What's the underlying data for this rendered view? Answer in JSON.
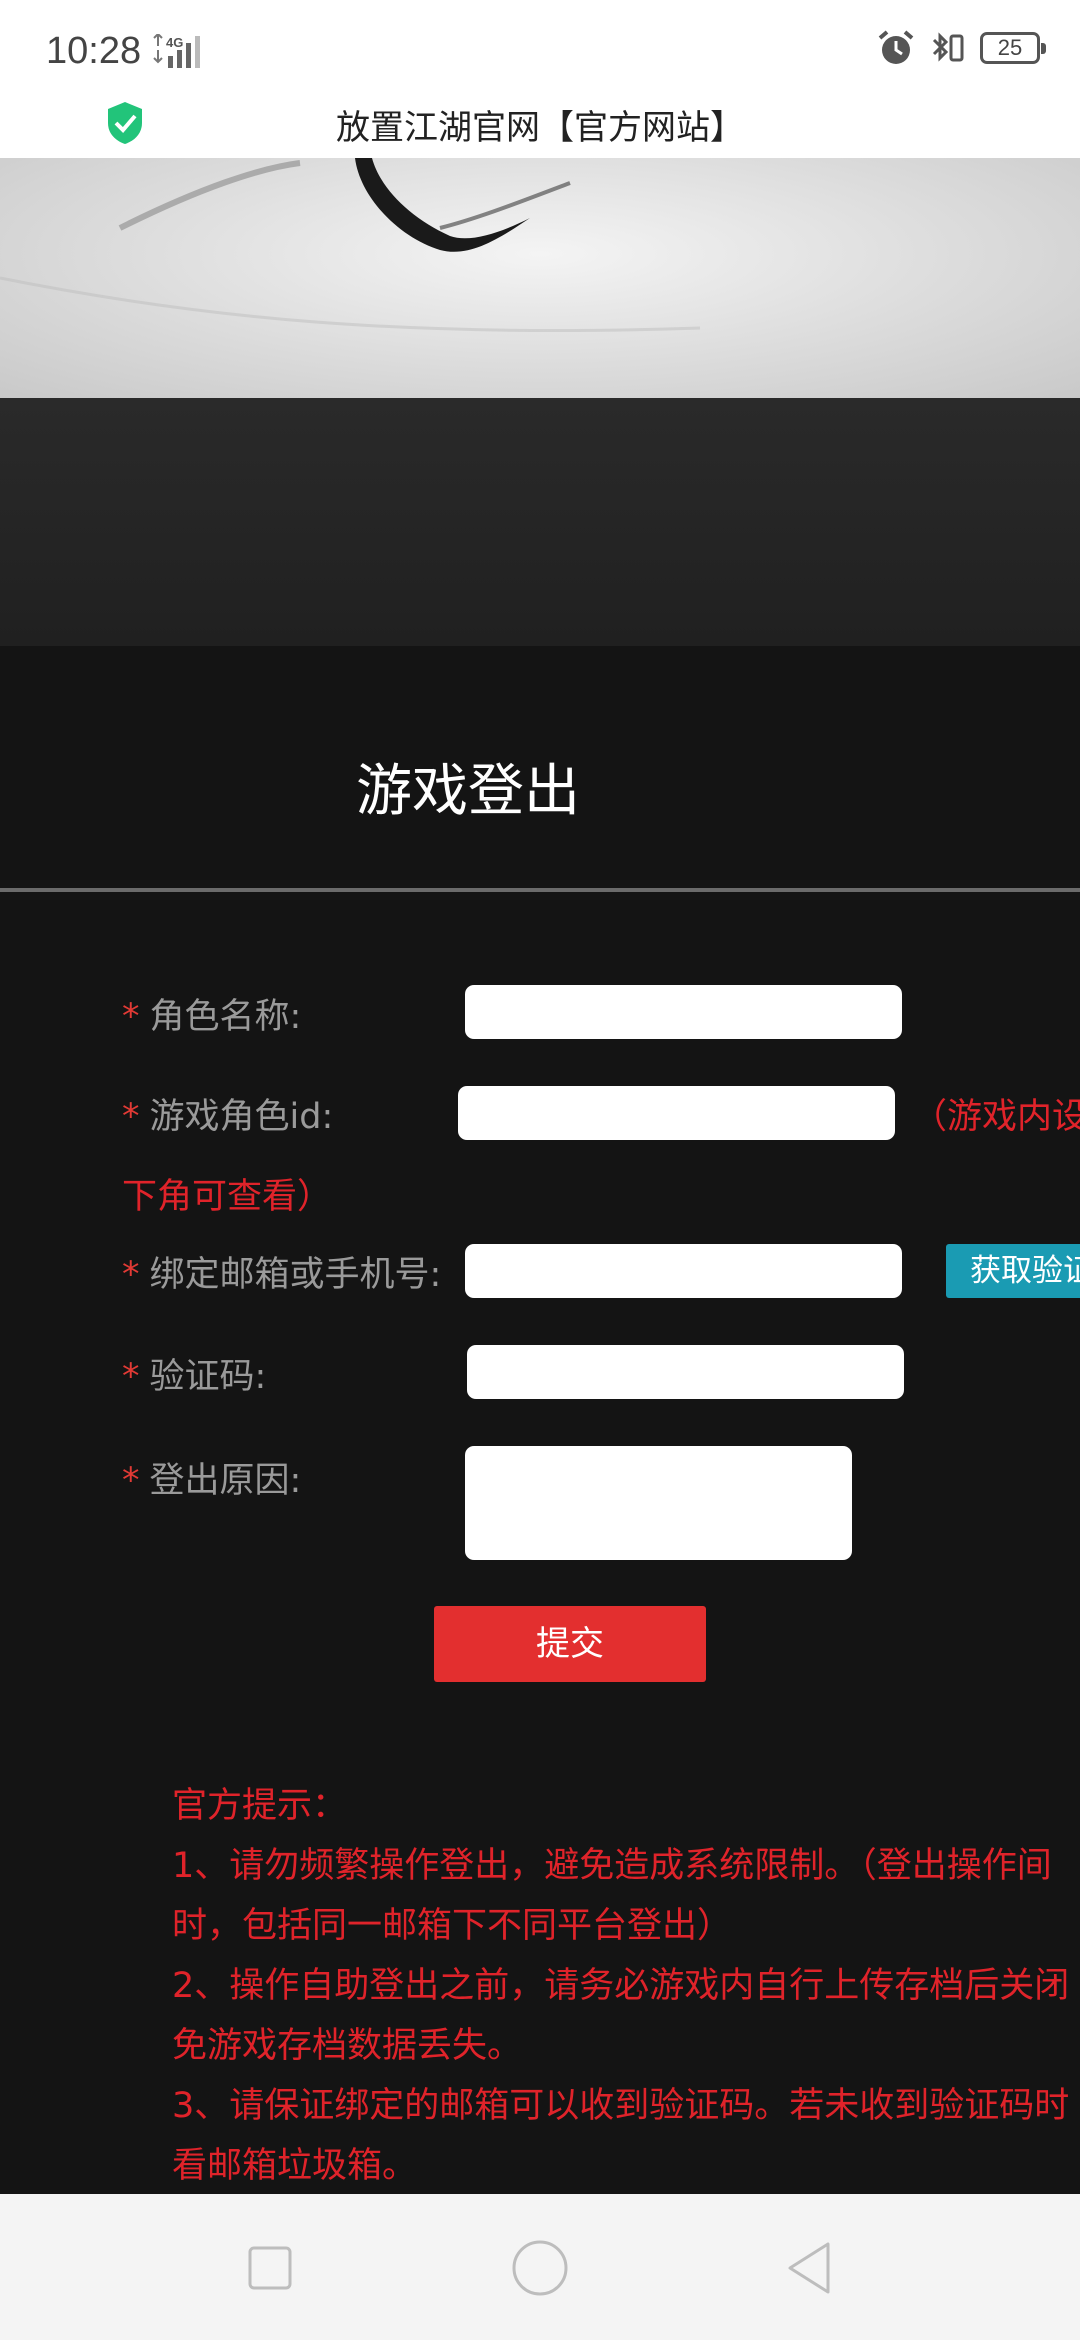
{
  "status_bar": {
    "time": "10:28",
    "network": "4G",
    "battery": "25"
  },
  "title_bar": {
    "title": "放置江湖官网【官方网站】",
    "shield_color": "#22c47a"
  },
  "form": {
    "heading": "游戏登出",
    "required_mark": "*",
    "role_name_label": "角色名称:",
    "role_name_value": "",
    "role_id_label": "游戏角色id:",
    "role_id_value": "",
    "role_id_hint_part1": "（游戏内设",
    "role_id_hint_part2": "下角可查看）",
    "account_label": "绑定邮箱或手机号:",
    "account_value": "",
    "get_code_label": "获取验证",
    "code_label": "验证码:",
    "code_value": "",
    "reason_label": "登出原因:",
    "reason_value": "",
    "submit_label": "提交"
  },
  "tips": {
    "title": "官方提示：",
    "lines": [
      "1、请勿频繁操作登出，避免造成系统限制。（登出操作间",
      "时，包括同一邮箱下不同平台登出）",
      "2、操作自助登出之前，请务必游戏内自行上传存档后关闭",
      "免游戏存档数据丢失。",
      "3、请保证绑定的邮箱可以收到验证码。若未收到验证码时",
      "看邮箱垃圾箱。"
    ]
  },
  "colors": {
    "accent_red": "#e32f2f",
    "hint_red": "#e0232a",
    "button_teal": "#1a9bb3"
  },
  "nav_bar": {
    "icons": [
      "square-icon",
      "circle-icon",
      "back-triangle-icon"
    ]
  }
}
